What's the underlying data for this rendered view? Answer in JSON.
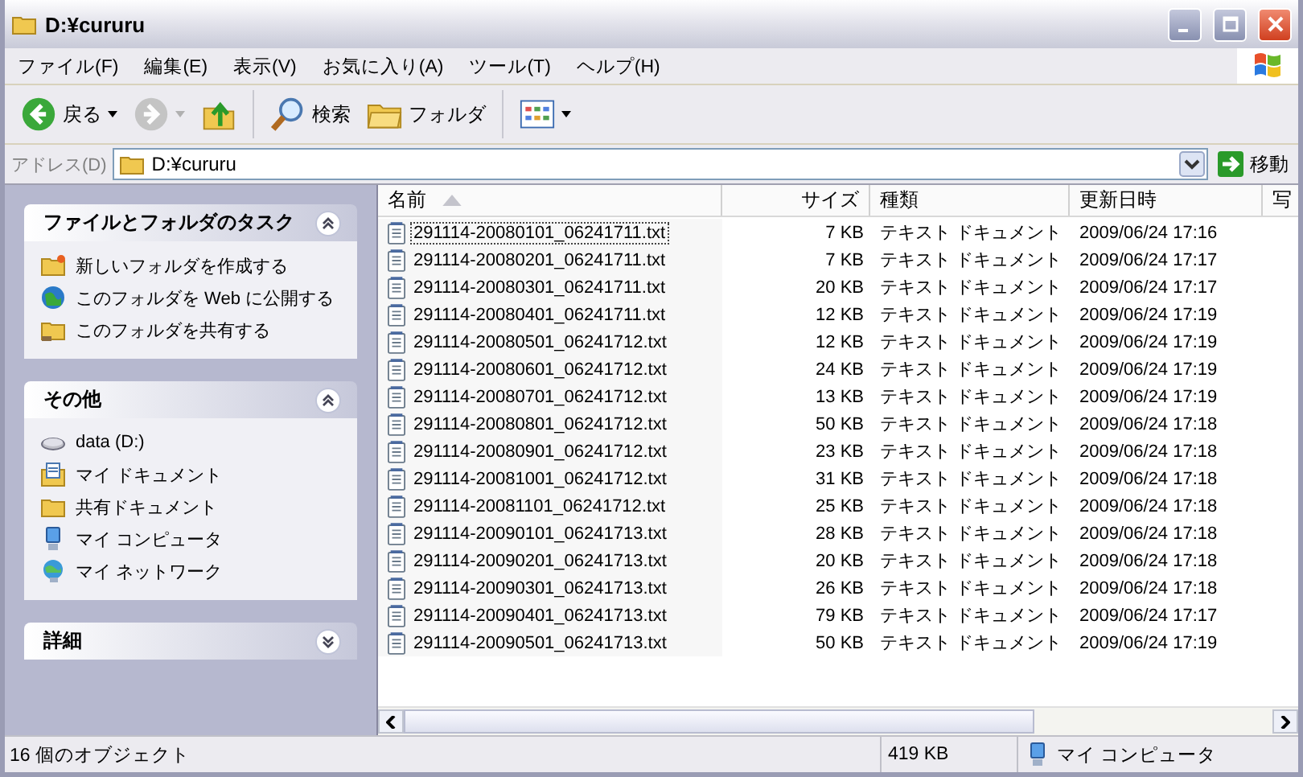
{
  "window": {
    "title": "D:¥cururu"
  },
  "menu": [
    "ファイル(F)",
    "編集(E)",
    "表示(V)",
    "お気に入り(A)",
    "ツール(T)",
    "ヘルプ(H)"
  ],
  "toolbar": [
    {
      "kind": "back",
      "label": "戻る",
      "disabled": false
    },
    {
      "kind": "forward",
      "disabled": true
    },
    {
      "kind": "up",
      "disabled": false
    },
    {
      "kind": "search",
      "label": "検索",
      "disabled": false
    },
    {
      "kind": "folders",
      "label": "フォルダ",
      "disabled": false
    },
    {
      "kind": "views",
      "disabled": false
    }
  ],
  "address": {
    "label": "アドレス(D)",
    "value": "D:¥cururu",
    "go": "移動"
  },
  "sidebar": [
    {
      "title": "ファイルとフォルダのタスク",
      "expanded": true,
      "items": [
        {
          "kind": "new-folder",
          "label": "新しいフォルダを作成する"
        },
        {
          "kind": "globe",
          "label": "このフォルダを Web に公開する"
        },
        {
          "kind": "share",
          "label": "このフォルダを共有する"
        }
      ]
    },
    {
      "title": "その他",
      "expanded": true,
      "items": [
        {
          "kind": "drive",
          "label": "data (D:)"
        },
        {
          "kind": "documents",
          "label": "マイ ドキュメント"
        },
        {
          "kind": "folder",
          "label": "共有ドキュメント"
        },
        {
          "kind": "computer",
          "label": "マイ コンピュータ"
        },
        {
          "kind": "network",
          "label": "マイ ネットワーク"
        }
      ]
    },
    {
      "title": "詳細",
      "expanded": false
    }
  ],
  "table": {
    "columns": [
      {
        "label": "名前",
        "sorted": true
      },
      {
        "label": "サイズ",
        "sorted": false
      },
      {
        "label": "種類",
        "sorted": false
      },
      {
        "label": "更新日時",
        "sorted": false
      },
      {
        "label": "写",
        "sorted": false
      }
    ],
    "rows": [
      {
        "name": "291114-20080101_06241711.txt",
        "size": "7 KB",
        "type": "テキスト ドキュメント",
        "modified": "2009/06/24 17:16",
        "focused": true
      },
      {
        "name": "291114-20080201_06241711.txt",
        "size": "7 KB",
        "type": "テキスト ドキュメント",
        "modified": "2009/06/24 17:17",
        "focused": false
      },
      {
        "name": "291114-20080301_06241711.txt",
        "size": "20 KB",
        "type": "テキスト ドキュメント",
        "modified": "2009/06/24 17:17",
        "focused": false
      },
      {
        "name": "291114-20080401_06241711.txt",
        "size": "12 KB",
        "type": "テキスト ドキュメント",
        "modified": "2009/06/24 17:19",
        "focused": false
      },
      {
        "name": "291114-20080501_06241712.txt",
        "size": "12 KB",
        "type": "テキスト ドキュメント",
        "modified": "2009/06/24 17:19",
        "focused": false
      },
      {
        "name": "291114-20080601_06241712.txt",
        "size": "24 KB",
        "type": "テキスト ドキュメント",
        "modified": "2009/06/24 17:19",
        "focused": false
      },
      {
        "name": "291114-20080701_06241712.txt",
        "size": "13 KB",
        "type": "テキスト ドキュメント",
        "modified": "2009/06/24 17:19",
        "focused": false
      },
      {
        "name": "291114-20080801_06241712.txt",
        "size": "50 KB",
        "type": "テキスト ドキュメント",
        "modified": "2009/06/24 17:18",
        "focused": false
      },
      {
        "name": "291114-20080901_06241712.txt",
        "size": "23 KB",
        "type": "テキスト ドキュメント",
        "modified": "2009/06/24 17:18",
        "focused": false
      },
      {
        "name": "291114-20081001_06241712.txt",
        "size": "31 KB",
        "type": "テキスト ドキュメント",
        "modified": "2009/06/24 17:18",
        "focused": false
      },
      {
        "name": "291114-20081101_06241712.txt",
        "size": "25 KB",
        "type": "テキスト ドキュメント",
        "modified": "2009/06/24 17:18",
        "focused": false
      },
      {
        "name": "291114-20090101_06241713.txt",
        "size": "28 KB",
        "type": "テキスト ドキュメント",
        "modified": "2009/06/24 17:18",
        "focused": false
      },
      {
        "name": "291114-20090201_06241713.txt",
        "size": "20 KB",
        "type": "テキスト ドキュメント",
        "modified": "2009/06/24 17:18",
        "focused": false
      },
      {
        "name": "291114-20090301_06241713.txt",
        "size": "26 KB",
        "type": "テキスト ドキュメント",
        "modified": "2009/06/24 17:18",
        "focused": false
      },
      {
        "name": "291114-20090401_06241713.txt",
        "size": "79 KB",
        "type": "テキスト ドキュメント",
        "modified": "2009/06/24 17:17",
        "focused": false
      },
      {
        "name": "291114-20090501_06241713.txt",
        "size": "50 KB",
        "type": "テキスト ドキュメント",
        "modified": "2009/06/24 17:19",
        "focused": false
      }
    ]
  },
  "status_bar": {
    "objects": "16 個のオブジェクト",
    "size": "419 KB",
    "location": "マイ コンピュータ"
  }
}
